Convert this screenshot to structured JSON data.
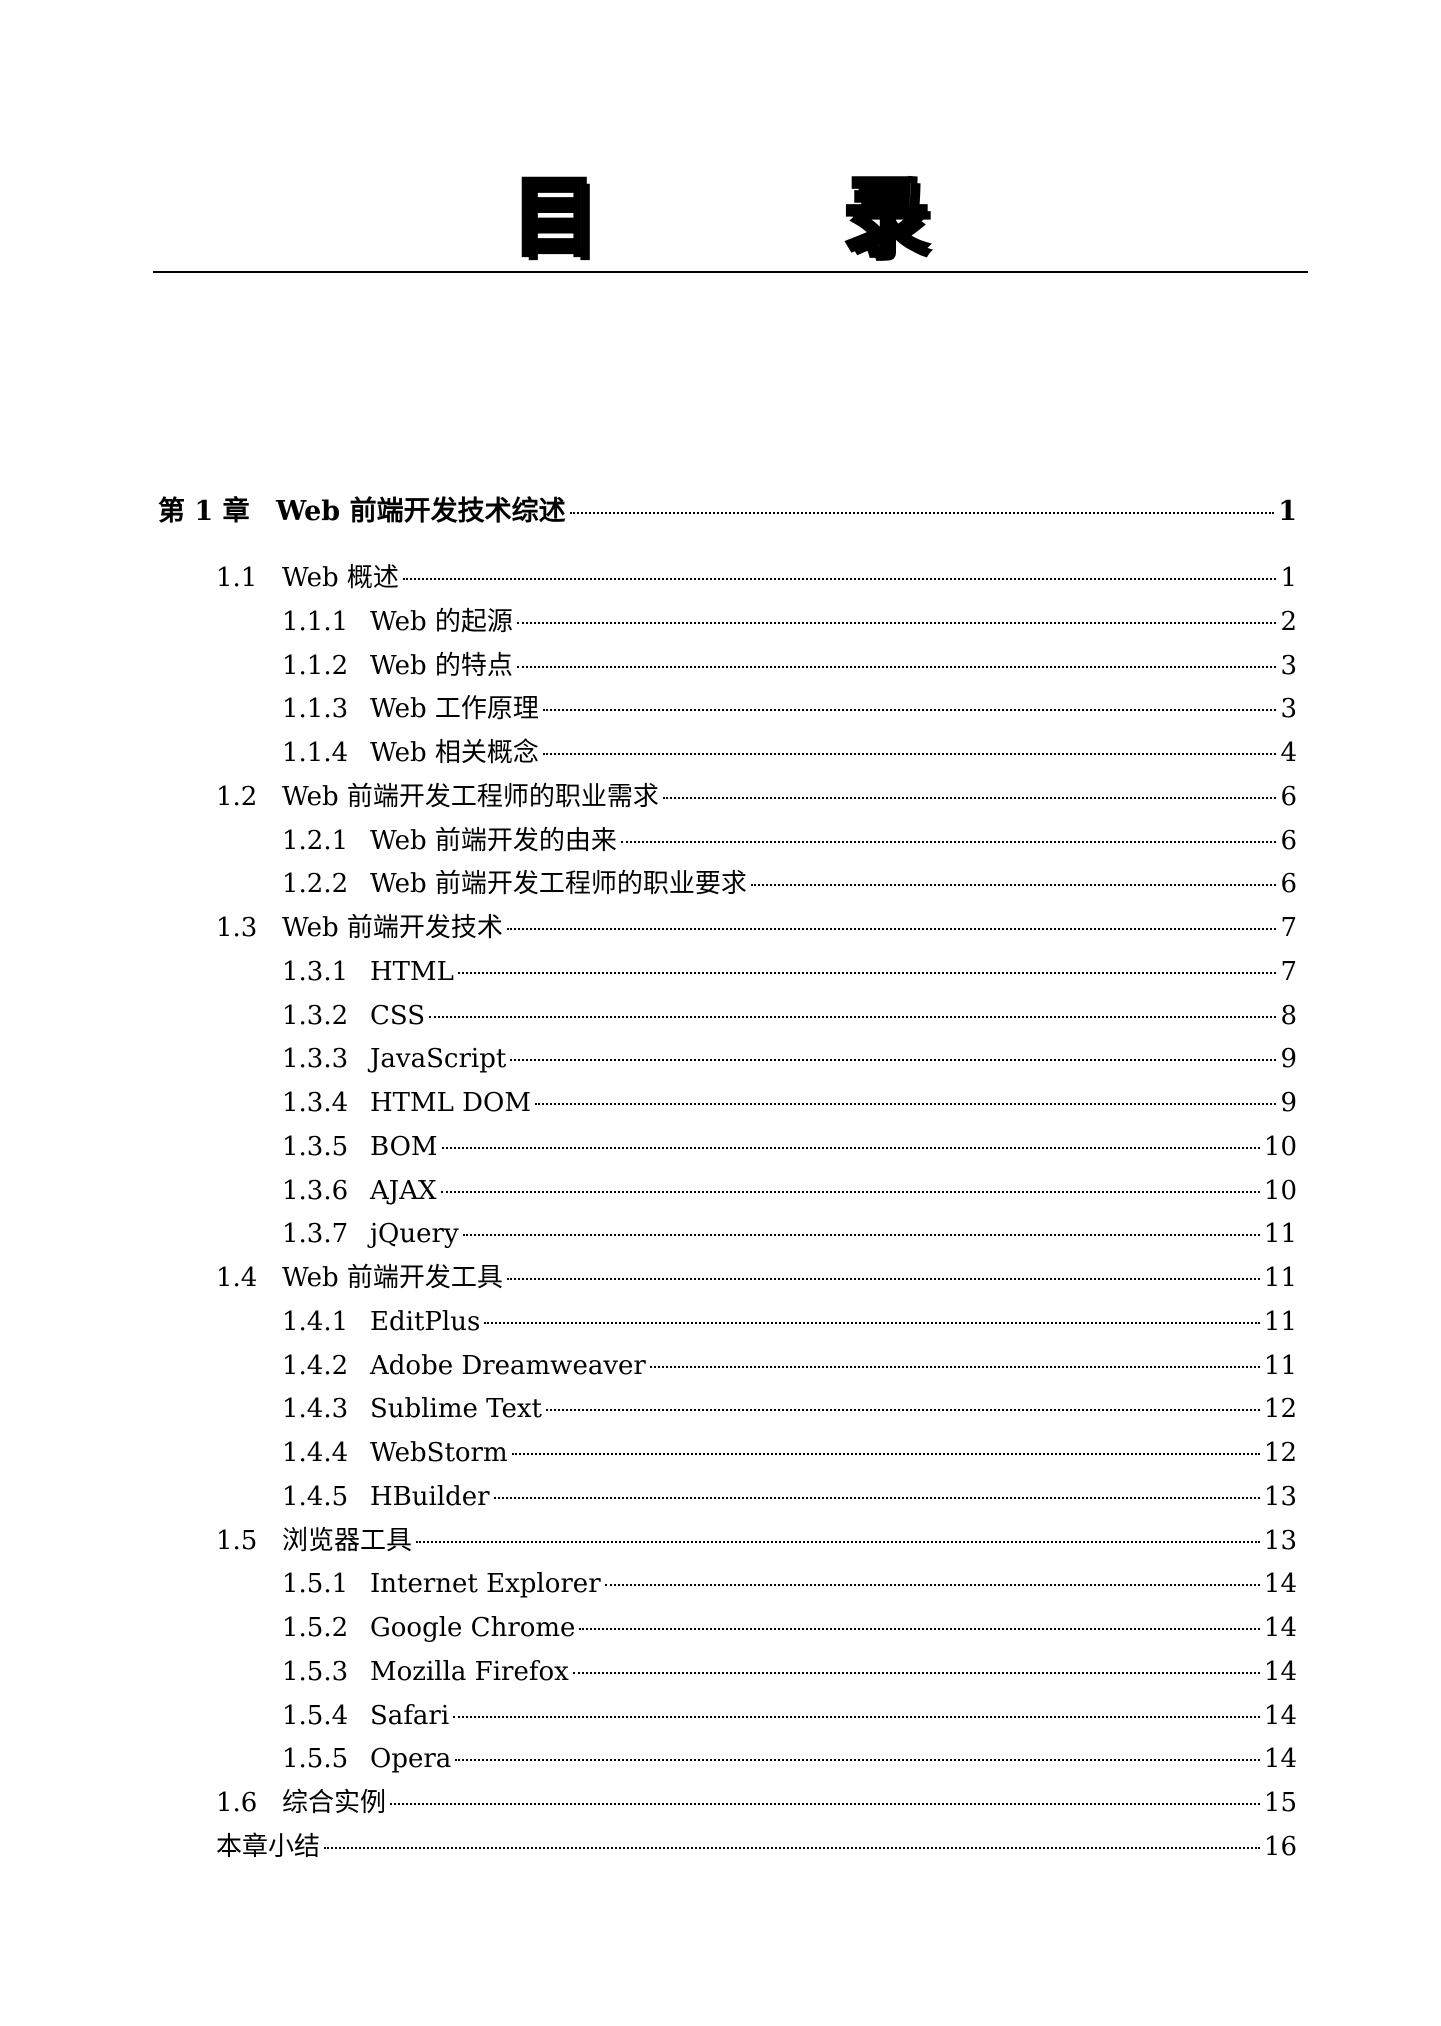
{
  "page_title": "目　录",
  "toc": [
    {
      "level": "chapter",
      "num": "第 1 章",
      "title": "Web 前端开发技术综述",
      "page": "1"
    },
    {
      "level": "section",
      "num": "1.1",
      "title": "Web 概述",
      "page": "1"
    },
    {
      "level": "sub",
      "num": "1.1.1",
      "title": "Web 的起源",
      "page": "2"
    },
    {
      "level": "sub",
      "num": "1.1.2",
      "title": "Web 的特点",
      "page": "3"
    },
    {
      "level": "sub",
      "num": "1.1.3",
      "title": "Web 工作原理",
      "page": "3"
    },
    {
      "level": "sub",
      "num": "1.1.4",
      "title": "Web 相关概念",
      "page": "4"
    },
    {
      "level": "section",
      "num": "1.2",
      "title": "Web 前端开发工程师的职业需求",
      "page": "6"
    },
    {
      "level": "sub",
      "num": "1.2.1",
      "title": "Web 前端开发的由来",
      "page": "6"
    },
    {
      "level": "sub",
      "num": "1.2.2",
      "title": "Web 前端开发工程师的职业要求",
      "page": "6"
    },
    {
      "level": "section",
      "num": "1.3",
      "title": "Web 前端开发技术",
      "page": "7"
    },
    {
      "level": "sub",
      "num": "1.3.1",
      "title": "HTML",
      "page": "7"
    },
    {
      "level": "sub",
      "num": "1.3.2",
      "title": "CSS",
      "page": "8"
    },
    {
      "level": "sub",
      "num": "1.3.3",
      "title": "JavaScript",
      "page": "9"
    },
    {
      "level": "sub",
      "num": "1.3.4",
      "title": "HTML DOM",
      "page": "9"
    },
    {
      "level": "sub",
      "num": "1.3.5",
      "title": "BOM",
      "page": "10"
    },
    {
      "level": "sub",
      "num": "1.3.6",
      "title": "AJAX",
      "page": "10"
    },
    {
      "level": "sub",
      "num": "1.3.7",
      "title": "jQuery",
      "page": "11"
    },
    {
      "level": "section",
      "num": "1.4",
      "title": "Web 前端开发工具",
      "page": "11"
    },
    {
      "level": "sub",
      "num": "1.4.1",
      "title": "EditPlus",
      "page": "11"
    },
    {
      "level": "sub",
      "num": "1.4.2",
      "title": "Adobe Dreamweaver",
      "page": "11"
    },
    {
      "level": "sub",
      "num": "1.4.3",
      "title": "Sublime Text",
      "page": "12"
    },
    {
      "level": "sub",
      "num": "1.4.4",
      "title": "WebStorm",
      "page": "12"
    },
    {
      "level": "sub",
      "num": "1.4.5",
      "title": "HBuilder",
      "page": "13"
    },
    {
      "level": "section",
      "num": "1.5",
      "title": "浏览器工具",
      "page": "13"
    },
    {
      "level": "sub",
      "num": "1.5.1",
      "title": "Internet Explorer",
      "page": "14"
    },
    {
      "level": "sub",
      "num": "1.5.2",
      "title": "Google Chrome",
      "page": "14"
    },
    {
      "level": "sub",
      "num": "1.5.3",
      "title": "Mozilla Firefox",
      "page": "14"
    },
    {
      "level": "sub",
      "num": "1.5.4",
      "title": "Safari",
      "page": "14"
    },
    {
      "level": "sub",
      "num": "1.5.5",
      "title": "Opera",
      "page": "14"
    },
    {
      "level": "section",
      "num": "1.6",
      "title": "综合实例",
      "page": "15"
    },
    {
      "level": "summary",
      "num": "",
      "title": "本章小结",
      "page": "16"
    }
  ]
}
